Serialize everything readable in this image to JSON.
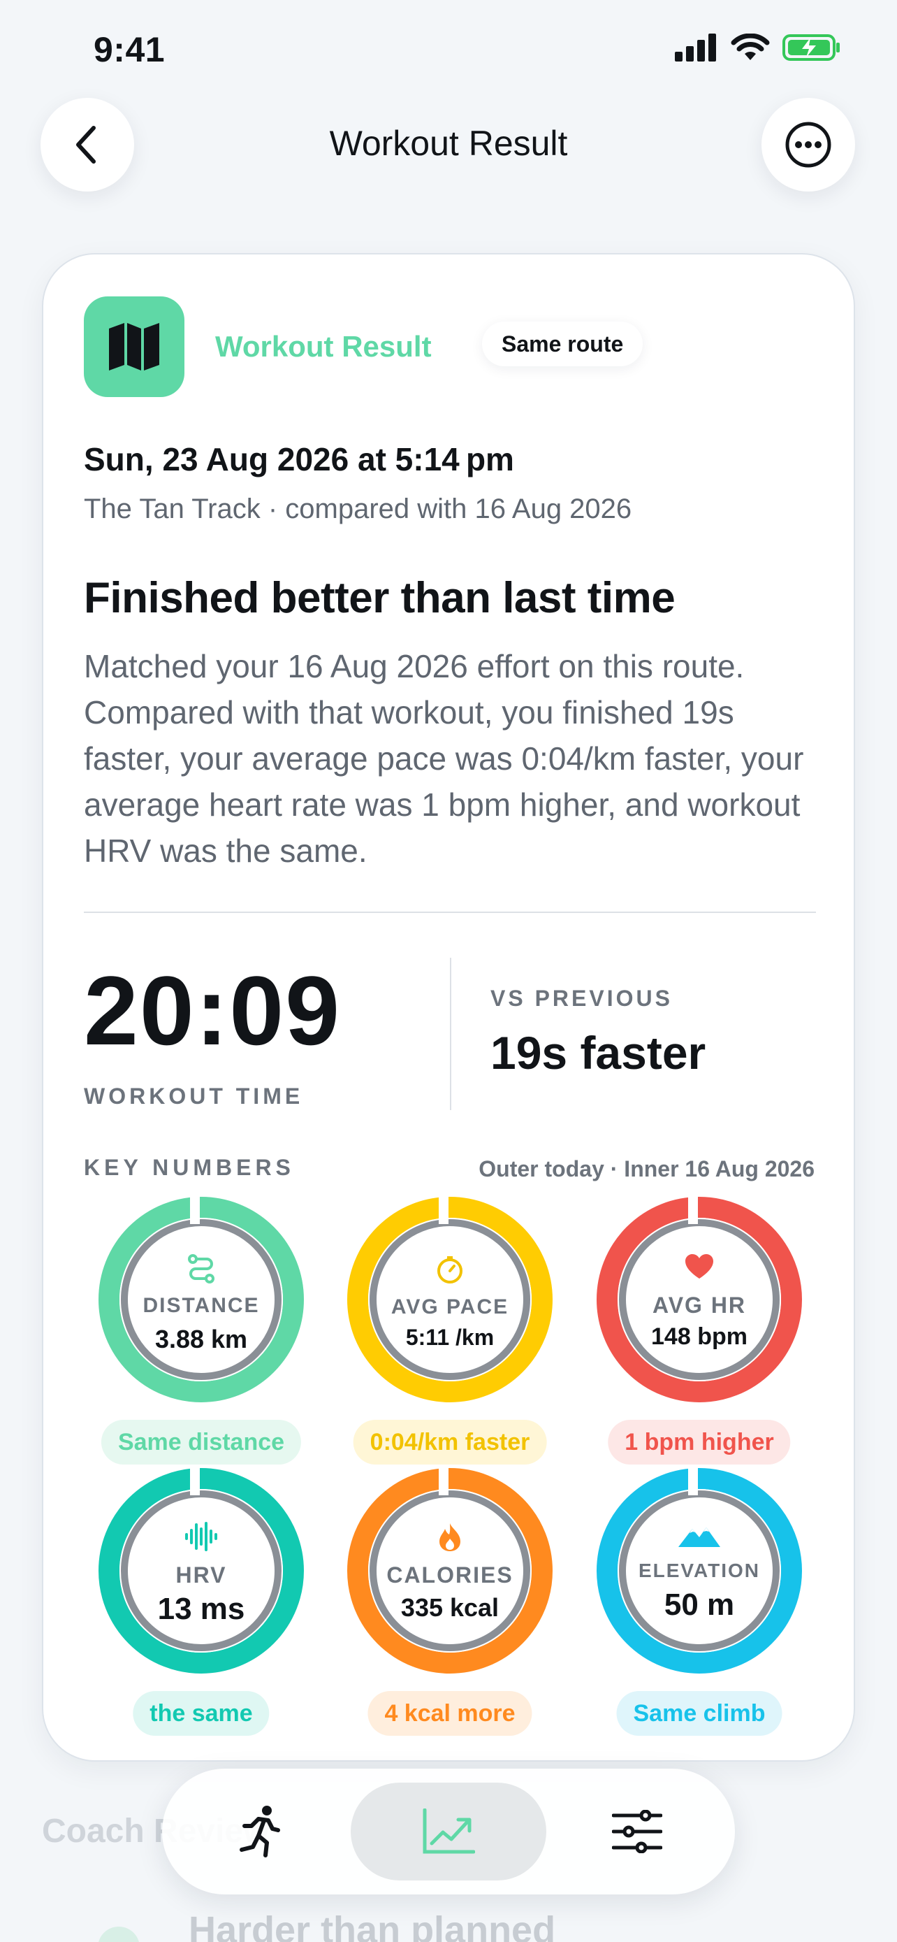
{
  "status_bar": {
    "time": "9:41"
  },
  "nav": {
    "title": "Workout Result"
  },
  "card": {
    "app_title": "Workout Result",
    "route_pill": "Same route",
    "date": "Sun, 23 Aug 2026 at 5:14 pm",
    "subtitle": "The Tan Track · compared with 16 Aug 2026",
    "headline": "Finished better than last time",
    "summary": "Matched your 16 Aug 2026 effort on this route. Compared with that workout, you finished 19s faster, your average pace was 0:04/km faster, your average heart rate was 1 bpm higher, and workout HRV was the same.",
    "workout_time": "20:09",
    "workout_time_label": "WORKOUT TIME",
    "vs_label": "VS PREVIOUS",
    "vs_value": "19s faster",
    "key_numbers_label": "KEY NUMBERS",
    "key_numbers_legend": "Outer today · Inner 16 Aug 2026"
  },
  "metrics": [
    {
      "name": "DISTANCE",
      "value": "3.88 km",
      "delta": "Same distance",
      "icon": "route-icon",
      "color": "#5fd8a6",
      "delta_bg": "#e6f8f0",
      "delta_color": "#5fd8a6"
    },
    {
      "name": "AVG PACE",
      "value": "5:11 /km",
      "delta": "0:04/km faster",
      "icon": "stopwatch-icon",
      "color": "#ffcc02",
      "delta_bg": "#fff6d6",
      "delta_color": "#f2c200"
    },
    {
      "name": "AVG HR",
      "value": "148 bpm",
      "delta": "1 bpm higher",
      "icon": "heart-icon",
      "color": "#f0544c",
      "delta_bg": "#fde7e6",
      "delta_color": "#f0544c"
    },
    {
      "name": "HRV",
      "value": "13 ms",
      "delta": "the same",
      "icon": "waveform-icon",
      "color": "#12c9b1",
      "delta_bg": "#dff7f3",
      "delta_color": "#12c9b1"
    },
    {
      "name": "CALORIES",
      "value": "335 kcal",
      "delta": "4 kcal more",
      "icon": "flame-icon",
      "color": "#ff8a1f",
      "delta_bg": "#ffeedd",
      "delta_color": "#ff8a1f"
    },
    {
      "name": "ELEVATION",
      "value": "50 m",
      "delta": "Same climb",
      "icon": "mountain-icon",
      "color": "#17c2ea",
      "delta_bg": "#dff5fb",
      "delta_color": "#17c2ea"
    }
  ],
  "below": {
    "section_label": "Coach Review",
    "item_title": "Harder than planned"
  },
  "tabbar": {
    "tabs": [
      "run-icon",
      "stats-icon",
      "settings-icon"
    ],
    "active": "stats-icon"
  }
}
